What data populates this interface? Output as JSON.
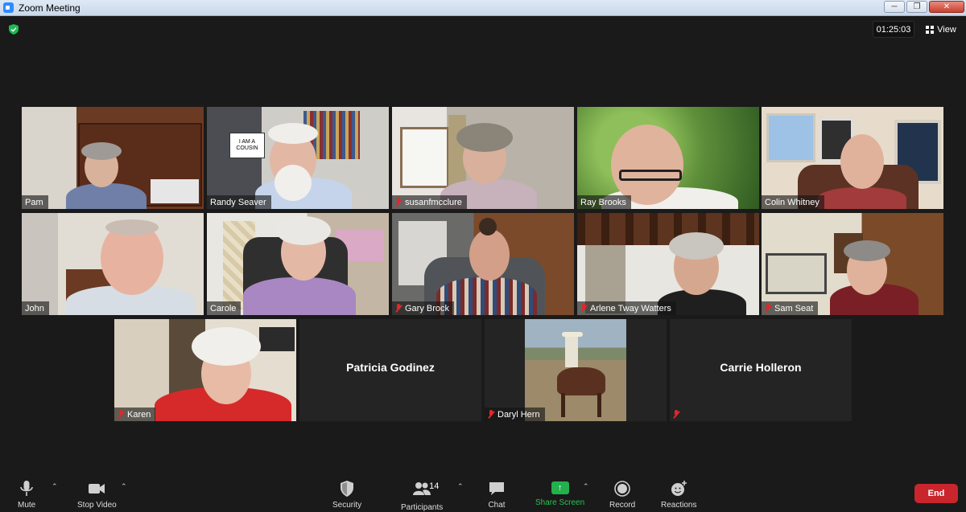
{
  "window": {
    "title": "Zoom Meeting",
    "controls": [
      "minimize",
      "restore",
      "close"
    ]
  },
  "topbar": {
    "timer": "01:25:03",
    "view_label": "View",
    "security_badge_color": "#1db954"
  },
  "participants": [
    {
      "name": "Pam",
      "muted": false
    },
    {
      "name": "Randy Seaver",
      "muted": false
    },
    {
      "name": "susanfmcclure",
      "muted": true
    },
    {
      "name": "Ray Brooks",
      "muted": false
    },
    {
      "name": "Colin Whitney",
      "muted": false,
      "active_speaker": true
    },
    {
      "name": "John",
      "muted": false
    },
    {
      "name": "Carole",
      "muted": false
    },
    {
      "name": "Gary Brock",
      "muted": true
    },
    {
      "name": "Arlene Tway Watters",
      "muted": true
    },
    {
      "name": "Sam Seat",
      "muted": true
    },
    {
      "name": "Karen",
      "muted": true
    },
    {
      "name": "Patricia Godinez",
      "muted": false,
      "video_off": true
    },
    {
      "name": "Daryl Hern",
      "muted": true
    },
    {
      "name": "Carrie Holleron",
      "muted": true,
      "video_off": true
    }
  ],
  "sign_text": "I AM A COUSIN",
  "toolbar": {
    "mute": "Mute",
    "stop_video": "Stop Video",
    "security": "Security",
    "participants": "Participants",
    "participants_count": "14",
    "chat": "Chat",
    "share_screen": "Share Screen",
    "record": "Record",
    "reactions": "Reactions",
    "end": "End"
  },
  "colors": {
    "active_speaker_border": "#e6e36a",
    "end_button": "#c9252c",
    "share_green": "#22b14c",
    "muted_red": "#e02828"
  }
}
